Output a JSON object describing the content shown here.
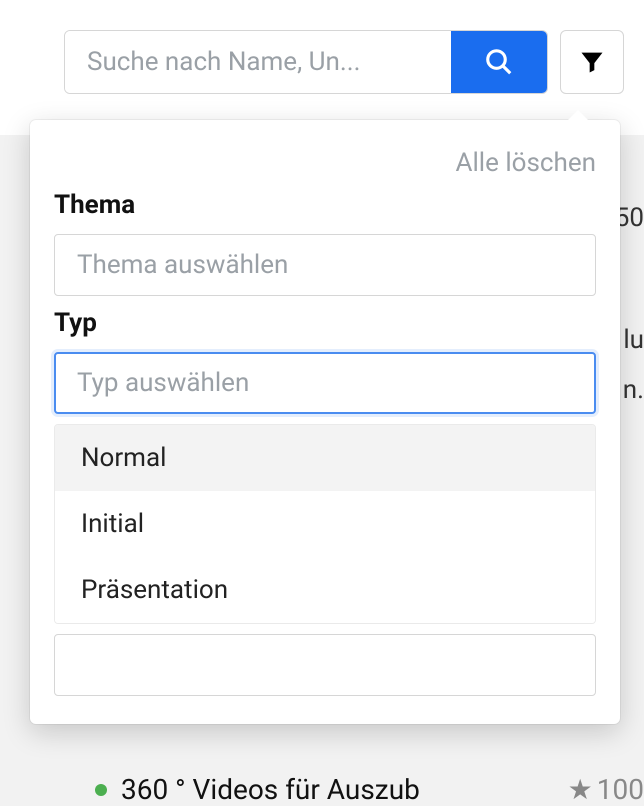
{
  "search": {
    "placeholder": "Suche nach Name, Un..."
  },
  "popover": {
    "clearAll": "Alle löschen",
    "thema": {
      "label": "Thema",
      "placeholder": "Thema auswählen"
    },
    "typ": {
      "label": "Typ",
      "placeholder": "Typ auswählen",
      "options": [
        "Normal",
        "Initial",
        "Präsentation"
      ]
    }
  },
  "background": {
    "partialRight1": "50",
    "partialRight2": "lu",
    "partialRight3": "n.",
    "listItem": "360 ° Videos für Auszub",
    "score": "100"
  }
}
